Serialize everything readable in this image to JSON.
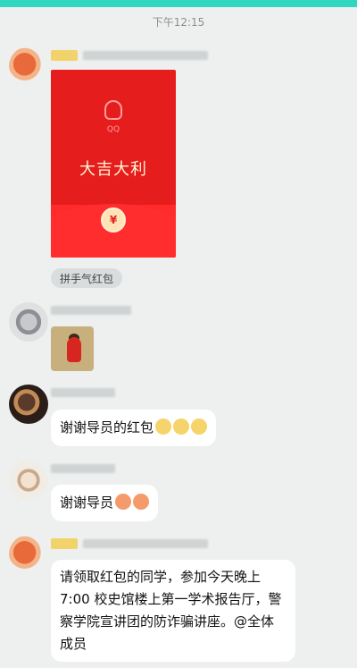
{
  "time": "下午12:15",
  "red_packet": {
    "brand": "QQ",
    "greeting": "大吉大利",
    "tag": "拼手气红包"
  },
  "messages": [
    {
      "text": "谢谢导员的红包",
      "emojis": [
        "emoji",
        "emoji",
        "emoji"
      ]
    },
    {
      "text": "谢谢导员",
      "emojis": [
        "emoji-red",
        "emoji-red"
      ]
    },
    {
      "text": "请领取红包的同学，参加今天晚上7:00 校史馆楼上第一学术报告厅，警察学院宣讲团的防诈骗讲座。@全体成员"
    }
  ],
  "colors": {
    "accent_bar": "#2fd7c0",
    "red_packet": "#e61d1d",
    "chat_bg": "#eef0ef"
  }
}
